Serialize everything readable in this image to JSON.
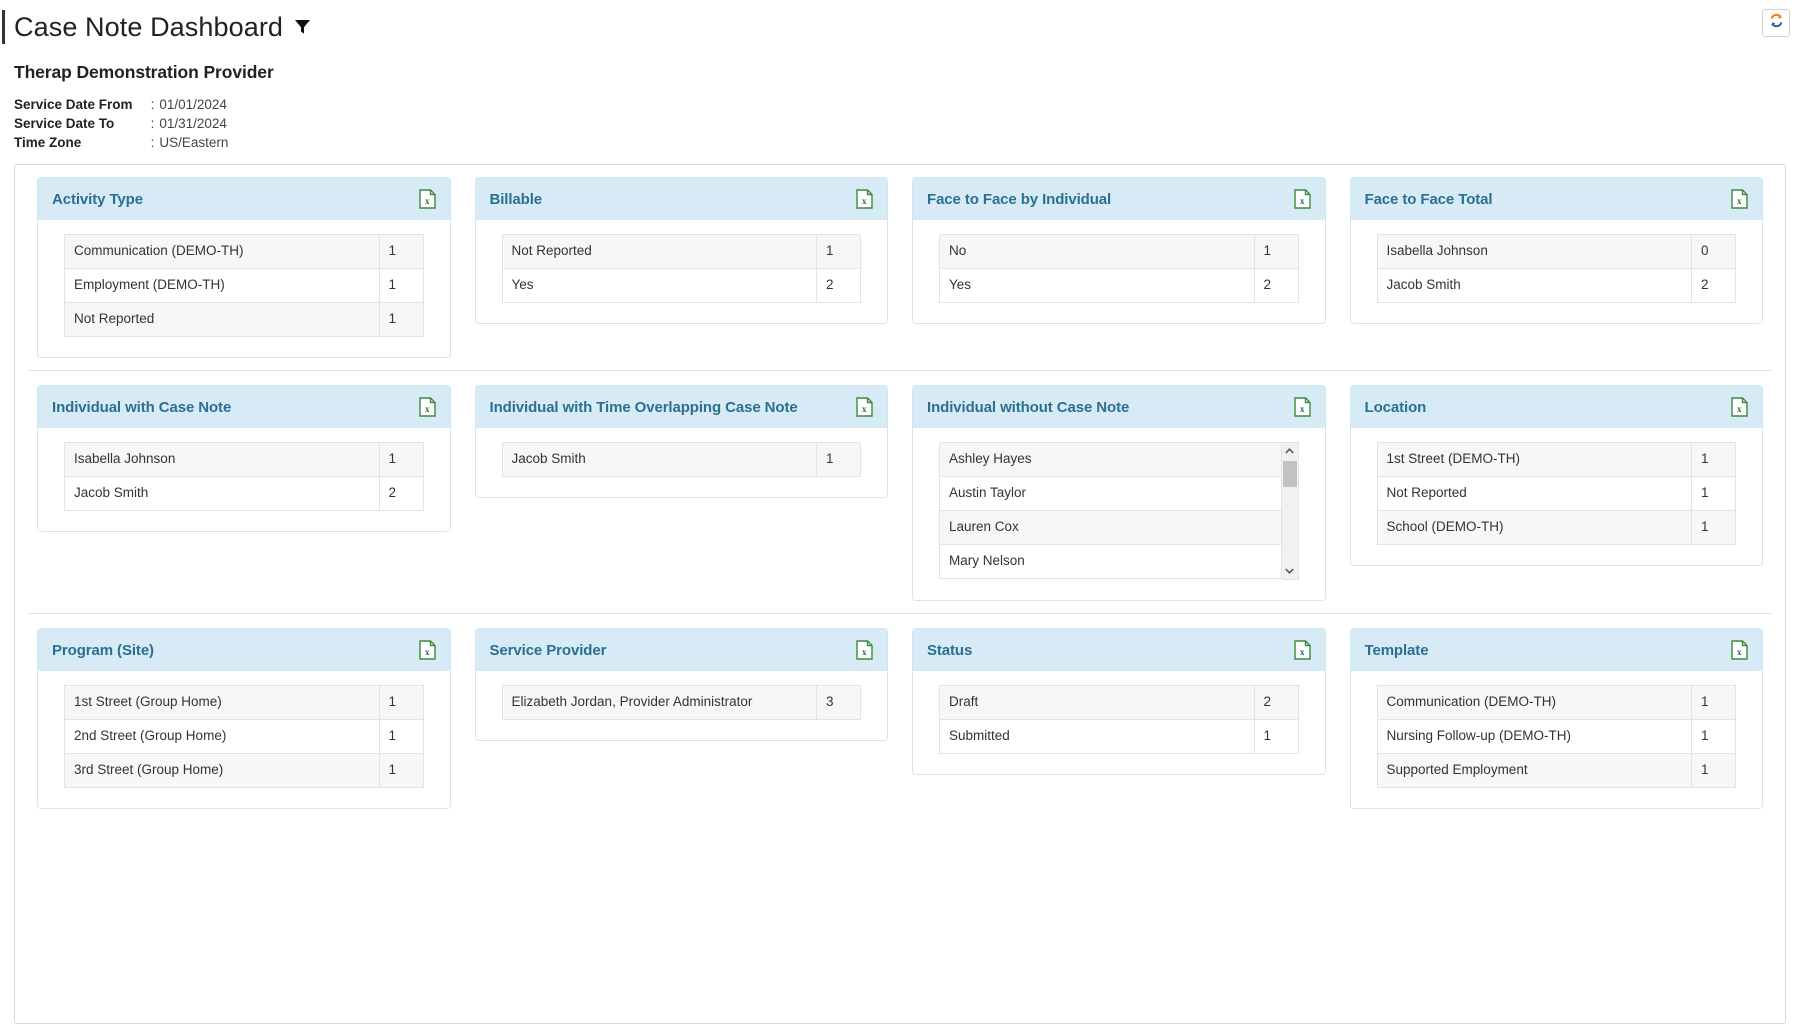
{
  "header": {
    "title": "Case Note Dashboard",
    "filter_icon": "filter-icon",
    "provider": "Therap Demonstration Provider",
    "refresh_icon": "refresh-icon",
    "meta": [
      {
        "label": "Service Date From",
        "colon": ":",
        "value": "01/01/2024"
      },
      {
        "label": "Service Date To",
        "colon": ":",
        "value": "01/31/2024"
      },
      {
        "label": "Time Zone",
        "colon": ":",
        "value": "US/Eastern"
      }
    ]
  },
  "colors": {
    "card_header_bg": "#d6ebf5",
    "card_title": "#2c6f93",
    "card_border": "#cfe7f1",
    "row_stripe": "#f7f7f7",
    "excel_green": "#3d8a3d",
    "refresh_orange": "#e8821e",
    "refresh_blue": "#1f66b0"
  },
  "export_icon_label": "excel-export-icon",
  "rows": [
    {
      "cards": [
        {
          "title": "Activity Type",
          "rows": [
            {
              "label": "Communication (DEMO-TH)",
              "value": "1"
            },
            {
              "label": "Employment (DEMO-TH)",
              "value": "1"
            },
            {
              "label": "Not Reported",
              "value": "1"
            }
          ]
        },
        {
          "title": "Billable",
          "rows": [
            {
              "label": "Not Reported",
              "value": "1"
            },
            {
              "label": "Yes",
              "value": "2"
            }
          ]
        },
        {
          "title": "Face to Face by Individual",
          "rows": [
            {
              "label": "No",
              "value": "1"
            },
            {
              "label": "Yes",
              "value": "2"
            }
          ]
        },
        {
          "title": "Face to Face Total",
          "rows": [
            {
              "label": "Isabella Johnson",
              "value": "0"
            },
            {
              "label": "Jacob Smith",
              "value": "2"
            }
          ]
        }
      ]
    },
    {
      "cards": [
        {
          "title": "Individual with Case Note",
          "rows": [
            {
              "label": "Isabella Johnson",
              "value": "1"
            },
            {
              "label": "Jacob Smith",
              "value": "2"
            }
          ]
        },
        {
          "title": "Individual with Time Overlapping Case Note",
          "rows": [
            {
              "label": "Jacob Smith",
              "value": "1"
            }
          ]
        },
        {
          "title": "Individual without Case Note",
          "scrollable": true,
          "rows": [
            {
              "label": "Ashley Hayes",
              "value": ""
            },
            {
              "label": "Austin Taylor",
              "value": ""
            },
            {
              "label": "Lauren Cox",
              "value": ""
            },
            {
              "label": "Mary Nelson",
              "value": ""
            }
          ]
        },
        {
          "title": "Location",
          "rows": [
            {
              "label": "1st Street (DEMO-TH)",
              "value": "1"
            },
            {
              "label": "Not Reported",
              "value": "1"
            },
            {
              "label": "School (DEMO-TH)",
              "value": "1"
            }
          ]
        }
      ]
    },
    {
      "cards": [
        {
          "title": "Program (Site)",
          "rows": [
            {
              "label": "1st Street (Group Home)",
              "value": "1"
            },
            {
              "label": "2nd Street (Group Home)",
              "value": "1"
            },
            {
              "label": "3rd Street (Group Home)",
              "value": "1"
            }
          ]
        },
        {
          "title": "Service Provider",
          "rows": [
            {
              "label": "Elizabeth Jordan, Provider Administrator",
              "value": "3"
            }
          ]
        },
        {
          "title": "Status",
          "rows": [
            {
              "label": "Draft",
              "value": "2"
            },
            {
              "label": "Submitted",
              "value": "1"
            }
          ]
        },
        {
          "title": "Template",
          "rows": [
            {
              "label": "Communication (DEMO-TH)",
              "value": "1"
            },
            {
              "label": "Nursing Follow-up (DEMO-TH)",
              "value": "1"
            },
            {
              "label": "Supported Employment",
              "value": "1"
            }
          ]
        }
      ]
    }
  ],
  "scrollbar": {
    "up_icon": "chevron-up-icon",
    "down_icon": "chevron-down-icon"
  }
}
